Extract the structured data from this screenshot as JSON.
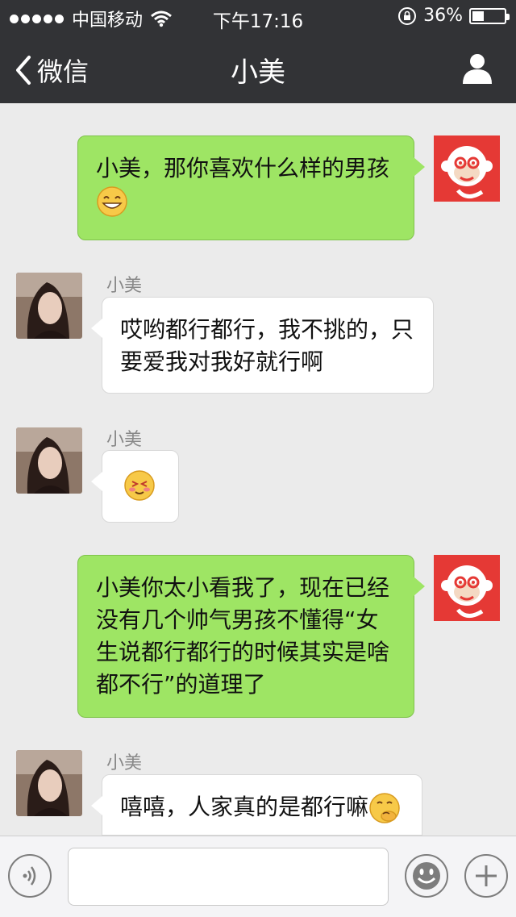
{
  "status_bar": {
    "carrier": "中国移动",
    "time": "下午17:16",
    "battery_percent": "36%",
    "battery_level": 0.36
  },
  "nav": {
    "back_label": "微信",
    "title": "小美"
  },
  "messages": [
    {
      "sender": "me",
      "text": "小美，那你喜欢什么样的男孩",
      "emoji": "grinning-face-emoji"
    },
    {
      "sender": "她",
      "name": "小美",
      "text": "哎哟都行都行，我不挑的，只要爱我对我好就行啊"
    },
    {
      "sender": "她",
      "name": "小美",
      "emoji": "blushing-face-emoji"
    },
    {
      "sender": "me",
      "text": "小美你太小看我了，现在已经没有几个帅气男孩不懂得“女生说都行都行的时候其实是啥都不行”的道理了"
    },
    {
      "sender": "她",
      "name": "小美",
      "text": "嘻嘻，人家真的是都行嘛",
      "emoji": "thinking-face-emoji"
    }
  ],
  "colors": {
    "bar": "#323336",
    "chat_bg": "#ebebeb",
    "my_bubble": "#9ee564",
    "her_bubble": "#ffffff",
    "my_avatar": "#e53935"
  }
}
